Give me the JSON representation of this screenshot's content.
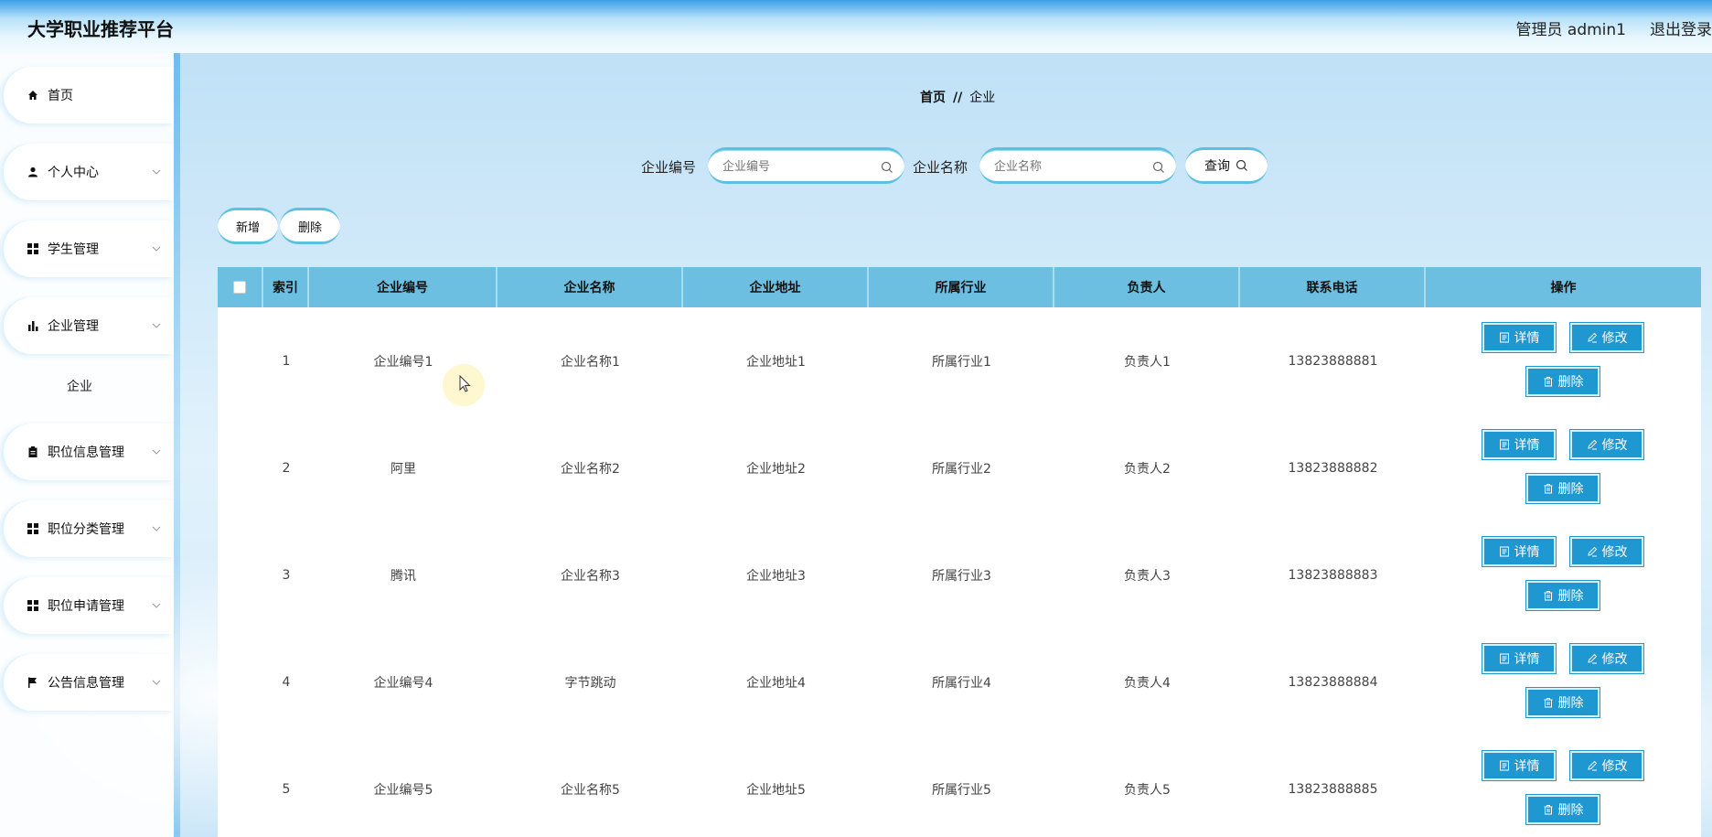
{
  "header": {
    "brand": "大学职业推荐平台",
    "user": "管理员 admin1",
    "logout": "退出登录"
  },
  "sidebar": {
    "items": [
      {
        "label": "首页",
        "icon": "home-icon"
      },
      {
        "label": "个人中心",
        "icon": "user-icon"
      },
      {
        "label": "学生管理",
        "icon": "grid-icon"
      },
      {
        "label": "企业管理",
        "icon": "bar-chart-icon"
      },
      {
        "label": "职位信息管理",
        "icon": "clipboard-icon"
      },
      {
        "label": "职位分类管理",
        "icon": "grid-icon"
      },
      {
        "label": "职位申请管理",
        "icon": "grid-icon"
      },
      {
        "label": "公告信息管理",
        "icon": "flag-icon"
      }
    ],
    "sub_item": "企业"
  },
  "breadcrumb": {
    "home": "首页",
    "separator": "//",
    "current": "企业"
  },
  "search": {
    "code_label": "企业编号",
    "code_placeholder": "企业编号",
    "name_label": "企业名称",
    "name_placeholder": "企业名称",
    "query_label": "查询"
  },
  "actions": {
    "add": "新增",
    "delete": "删除"
  },
  "table": {
    "headers": [
      "索引",
      "企业编号",
      "企业名称",
      "企业地址",
      "所属行业",
      "负责人",
      "联系电话",
      "操作"
    ],
    "rows": [
      [
        "1",
        "企业编号1",
        "企业名称1",
        "企业地址1",
        "所属行业1",
        "负责人1",
        "13823888881"
      ],
      [
        "2",
        "阿里",
        "企业名称2",
        "企业地址2",
        "所属行业2",
        "负责人2",
        "13823888882"
      ],
      [
        "3",
        "腾讯",
        "企业名称3",
        "企业地址3",
        "所属行业3",
        "负责人3",
        "13823888883"
      ],
      [
        "4",
        "企业编号4",
        "字节跳动",
        "企业地址4",
        "所属行业4",
        "负责人4",
        "13823888884"
      ],
      [
        "5",
        "企业编号5",
        "企业名称5",
        "企业地址5",
        "所属行业5",
        "负责人5",
        "13823888885"
      ]
    ],
    "row_buttons": {
      "detail": "详情",
      "edit": "修改",
      "delete": "删除"
    }
  },
  "colors": {
    "accent": "#1f97d0",
    "table_header": "#6cbfe0",
    "pill_border": "#5cc0e0"
  }
}
